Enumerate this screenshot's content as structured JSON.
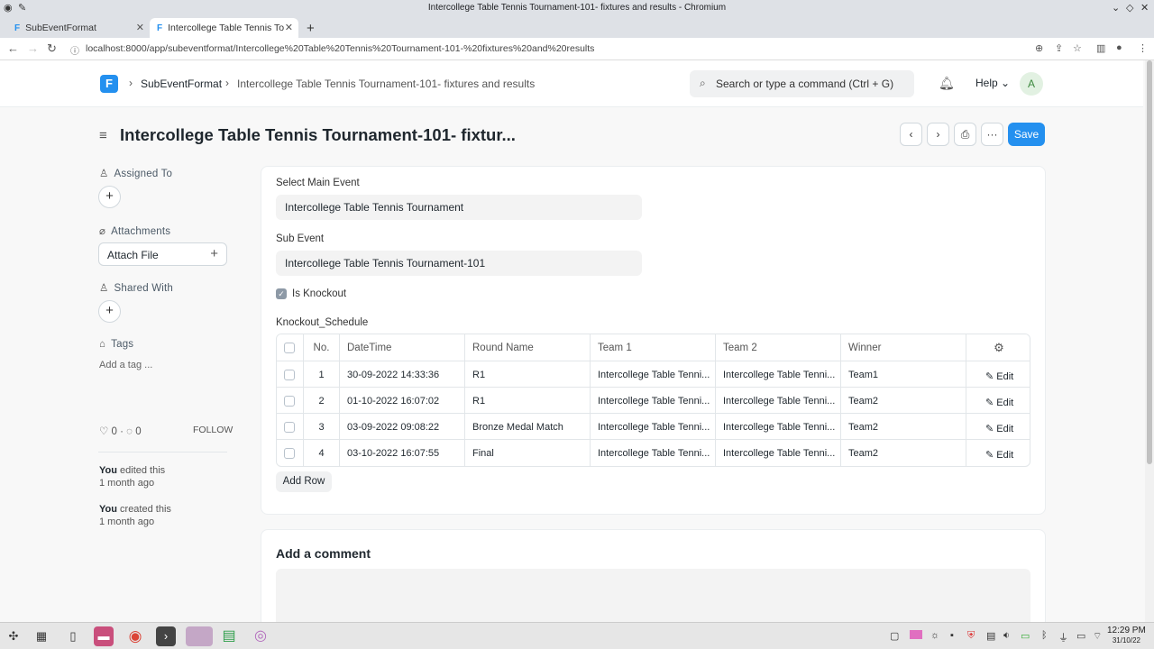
{
  "window": {
    "title": "Intercollege Table Tennis Tournament-101- fixtures and results - Chromium"
  },
  "tabs": [
    {
      "label": "SubEventFormat"
    },
    {
      "label": "Intercollege Table Tennis To"
    }
  ],
  "address": {
    "url": "localhost:8000/app/subeventformat/Intercollege%20Table%20Tennis%20Tournament-101-%20fixtures%20and%20results"
  },
  "navbar": {
    "logo": "F",
    "breadcrumb": [
      "SubEventFormat",
      "Intercollege Table Tennis Tournament-101- fixtures and results"
    ],
    "search_placeholder": "Search or type a command (Ctrl + G)",
    "help_label": "Help",
    "avatar_initial": "A"
  },
  "page": {
    "title": "Intercollege Table Tennis Tournament-101- fixtur...",
    "save_label": "Save"
  },
  "sidebar": {
    "assigned_to": "Assigned To",
    "attachments": "Attachments",
    "attach_file": "Attach File",
    "shared_with": "Shared With",
    "tags": "Tags",
    "add_tag": "Add a tag ...",
    "likes": "0",
    "comments": "0",
    "follow": "FOLLOW",
    "activity": [
      {
        "who": "You",
        "what": "edited this",
        "when": "1 month ago"
      },
      {
        "who": "You",
        "what": "created this",
        "when": "1 month ago"
      }
    ]
  },
  "form": {
    "main_event_label": "Select Main Event",
    "main_event_value": "Intercollege Table Tennis Tournament",
    "sub_event_label": "Sub Event",
    "sub_event_value": "Intercollege Table Tennis Tournament-101",
    "is_knockout_label": "Is Knockout",
    "is_knockout": true,
    "schedule_label": "Knockout_Schedule",
    "columns": [
      "No.",
      "DateTime",
      "Round Name",
      "Team 1",
      "Team 2",
      "Winner"
    ],
    "rows": [
      {
        "no": "1",
        "datetime": "30-09-2022 14:33:36",
        "round": "R1",
        "team1": "Intercollege Table Tenni...",
        "team2": "Intercollege Table Tenni...",
        "winner": "Team1",
        "edit": "Edit"
      },
      {
        "no": "2",
        "datetime": "01-10-2022 16:07:02",
        "round": "R1",
        "team1": "Intercollege Table Tenni...",
        "team2": "Intercollege Table Tenni...",
        "winner": "Team2",
        "edit": "Edit"
      },
      {
        "no": "3",
        "datetime": "03-09-2022 09:08:22",
        "round": "Bronze Medal Match",
        "team1": "Intercollege Table Tenni...",
        "team2": "Intercollege Table Tenni...",
        "winner": "Team2",
        "edit": "Edit"
      },
      {
        "no": "4",
        "datetime": "03-10-2022 16:07:55",
        "round": "Final",
        "team1": "Intercollege Table Tenni...",
        "team2": "Intercollege Table Tenni...",
        "winner": "Team2",
        "edit": "Edit"
      }
    ],
    "add_row": "Add Row"
  },
  "comment": {
    "title": "Add a comment"
  },
  "taskbar": {
    "time": "12:29 PM",
    "date": "31/10/22"
  },
  "colors": {
    "accent": "#2490ef"
  }
}
